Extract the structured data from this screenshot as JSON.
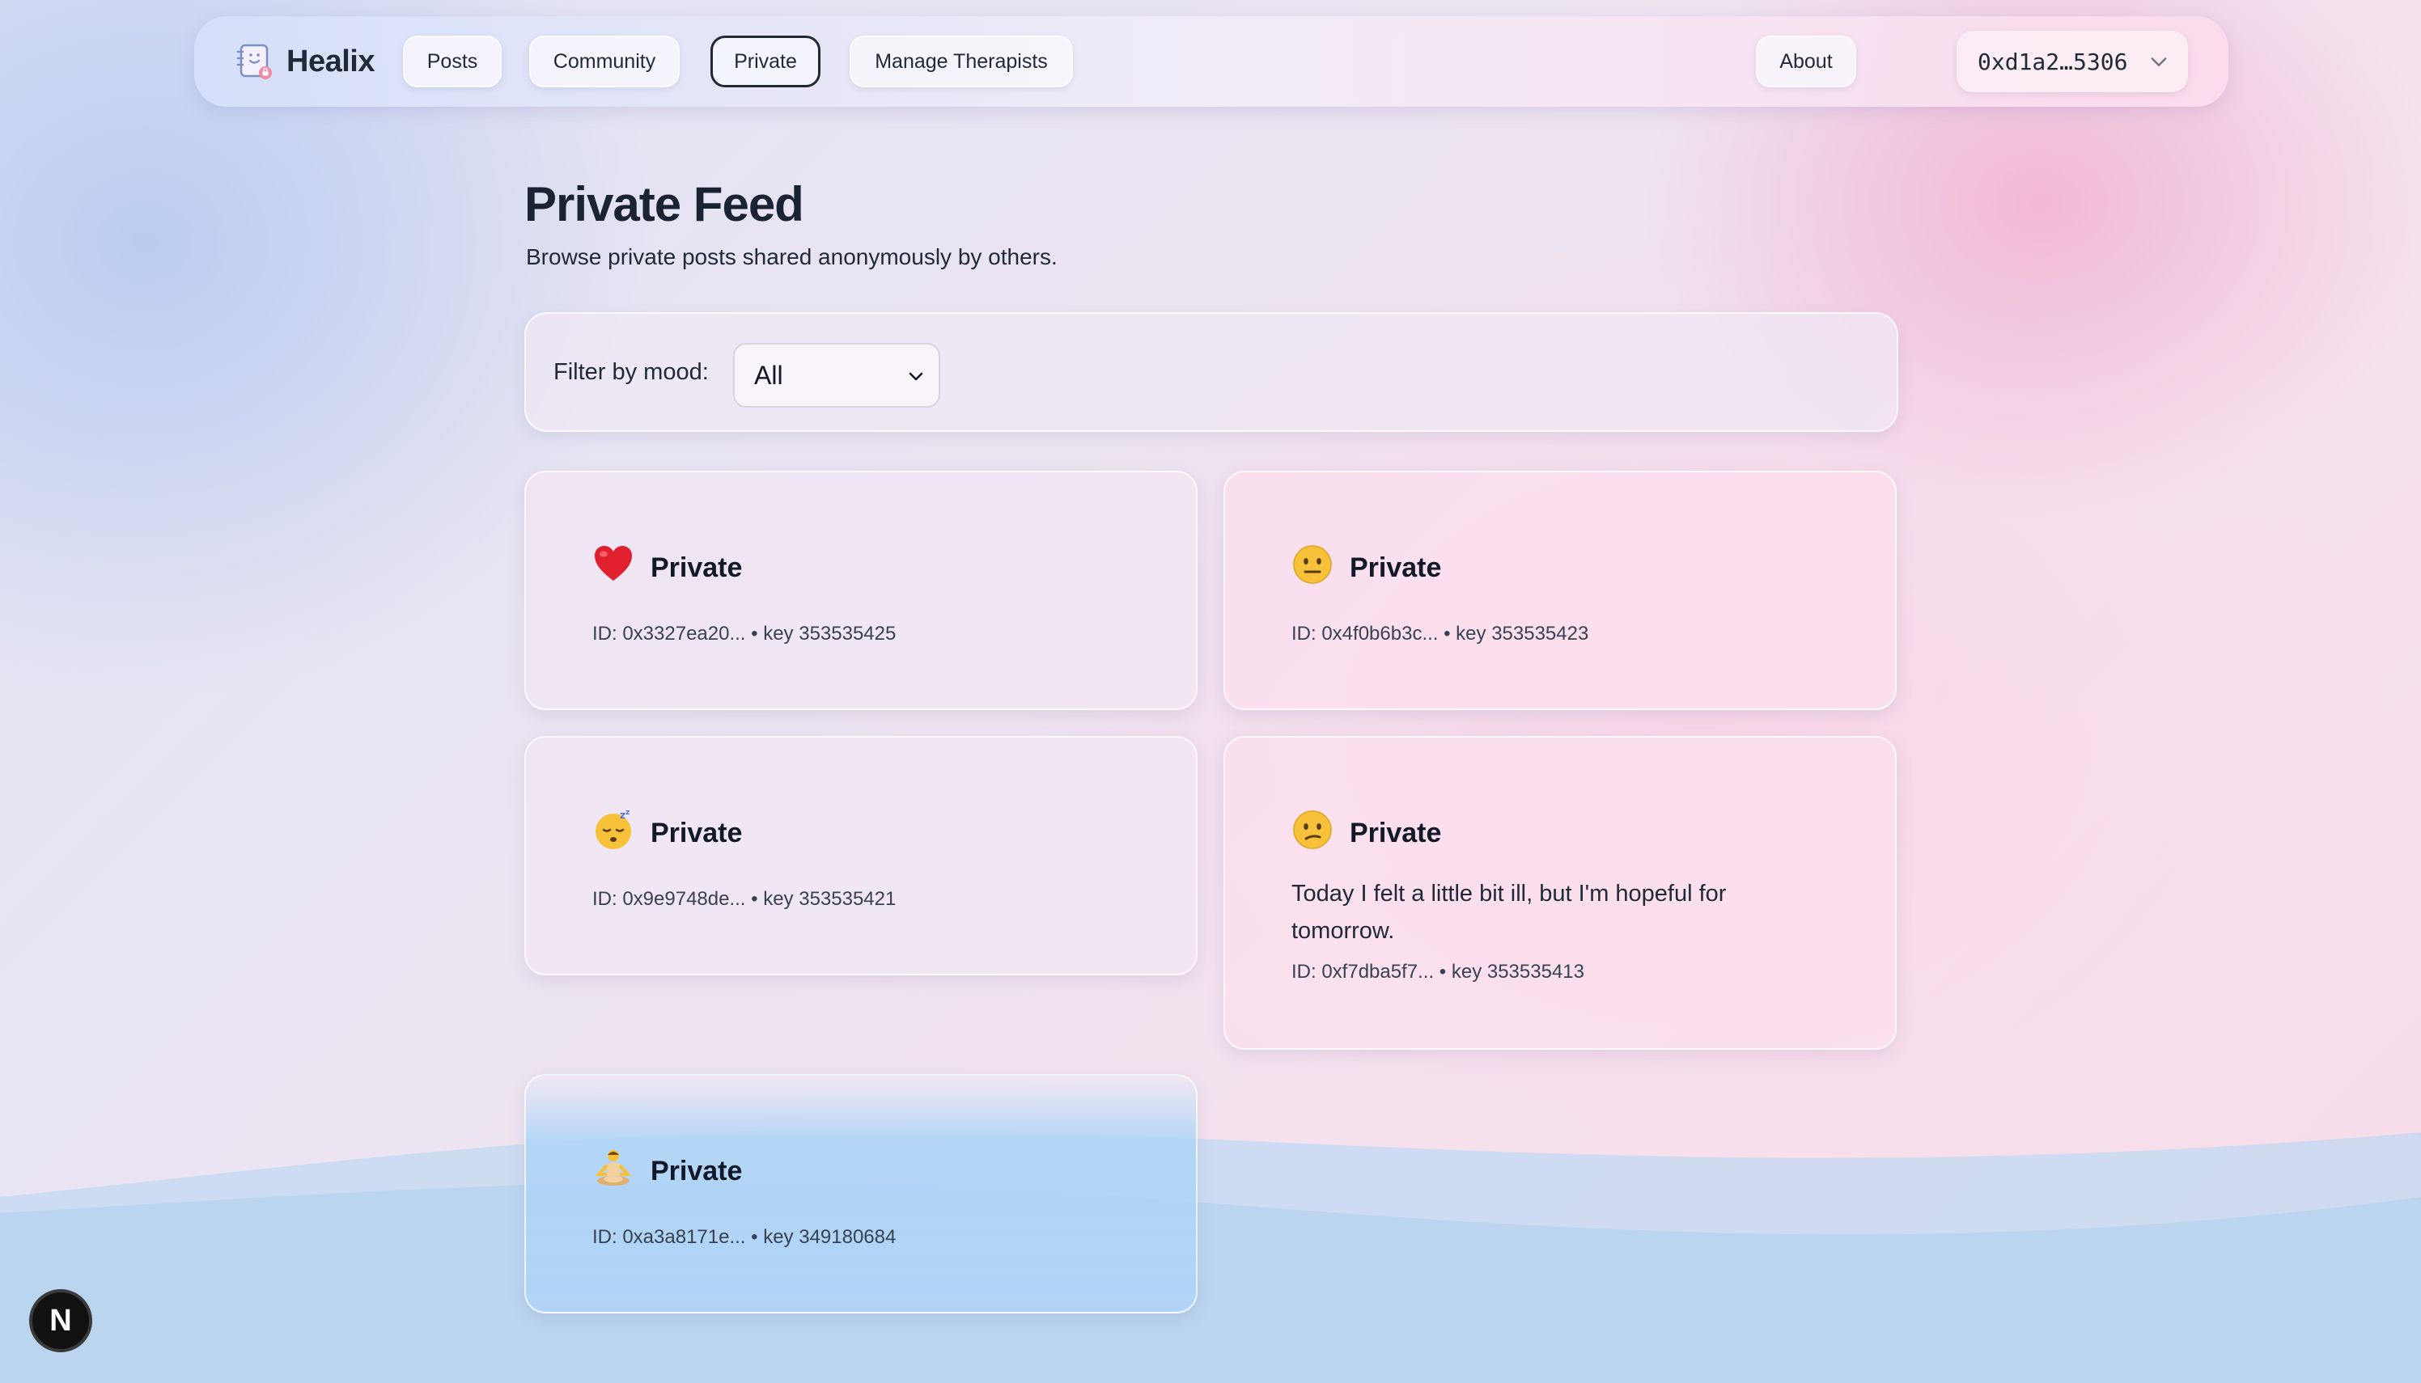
{
  "app": {
    "name": "Healix"
  },
  "nav": {
    "items": [
      {
        "label": "Posts"
      },
      {
        "label": "Community"
      },
      {
        "label": "Private",
        "active": true
      },
      {
        "label": "Manage Therapists"
      }
    ],
    "about_label": "About",
    "wallet_address": "0xd1a2…5306",
    "wallet_chevron_icon": "chevron-down-icon"
  },
  "page": {
    "title": "Private Feed",
    "subtitle": "Browse private posts shared anonymously by others."
  },
  "filter": {
    "label": "Filter by mood:",
    "selected": "All",
    "chevron_icon": "chevron-down-icon"
  },
  "posts": [
    {
      "mood_icon": "red-heart-icon",
      "title": "Private",
      "meta": "ID: 0x3327ea20... • key 353535425",
      "body": ""
    },
    {
      "mood_icon": "neutral-face-icon",
      "title": "Private",
      "meta": "ID: 0x4f0b6b3c... • key 353535423",
      "body": ""
    },
    {
      "mood_icon": "sleeping-face-icon",
      "title": "Private",
      "meta": "ID: 0x9e9748de... • key 353535421",
      "body": ""
    },
    {
      "mood_icon": "confused-face-icon",
      "title": "Private",
      "meta": "ID: 0xf7dba5f7... • key 353535413",
      "body": "Today I felt a little bit ill, but I'm hopeful for tomorrow."
    },
    {
      "mood_icon": "meditating-person-icon",
      "title": "Private",
      "meta": "ID: 0xa3a8171e... • key 349180684",
      "body": ""
    }
  ],
  "badge": {
    "label": "N"
  },
  "colors": {
    "text_dark": "#1a2333",
    "active_border": "#1f2937",
    "card_pink": "#fbe0ee",
    "card_lavender": "#f1e7f3",
    "card_blue": "#b0d4f6",
    "wave_blue": "#b6d6f0"
  }
}
